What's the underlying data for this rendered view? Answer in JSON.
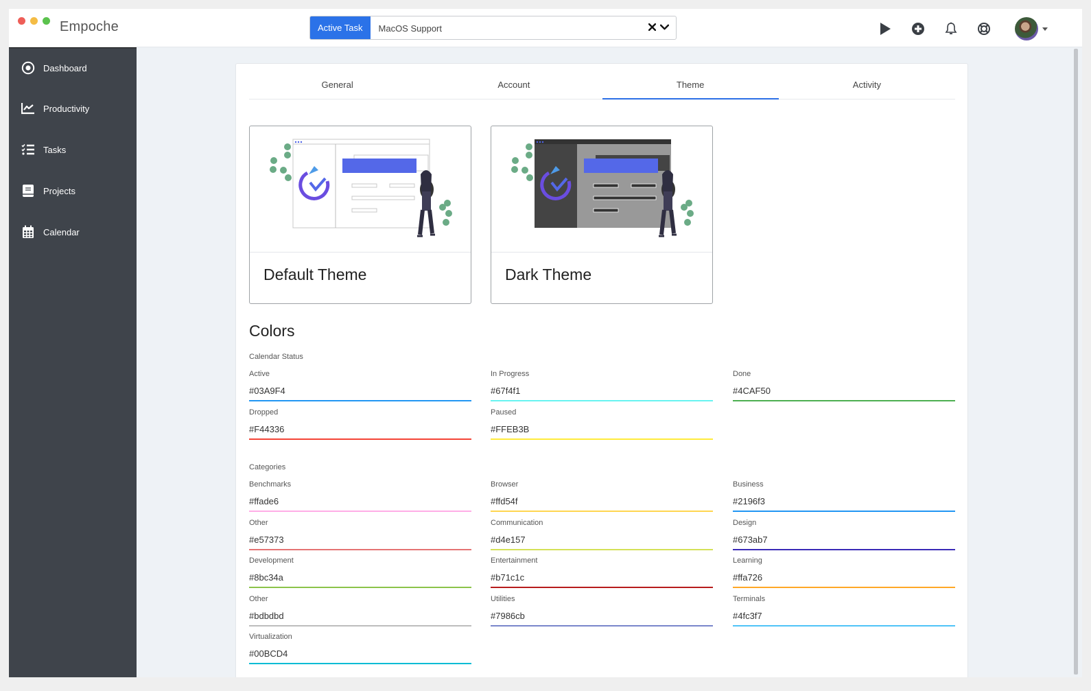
{
  "app": {
    "title": "Empoche"
  },
  "active_task": {
    "badge": "Active Task",
    "value": "MacOS Support",
    "clear_icon": "close-icon",
    "dropdown_icon": "chevron-down-icon"
  },
  "top_icons": [
    "play-icon",
    "plus-circle-icon",
    "bell-icon",
    "lifebuoy-icon",
    "avatar",
    "caret-down-icon"
  ],
  "sidebar": {
    "items": [
      {
        "label": "Dashboard",
        "icon": "dot-circle-icon"
      },
      {
        "label": "Productivity",
        "icon": "line-chart-icon"
      },
      {
        "label": "Tasks",
        "icon": "checklist-icon"
      },
      {
        "label": "Projects",
        "icon": "book-icon"
      },
      {
        "label": "Calendar",
        "icon": "calendar-icon"
      }
    ]
  },
  "tabs": [
    {
      "label": "General",
      "active": false
    },
    {
      "label": "Account",
      "active": false
    },
    {
      "label": "Theme",
      "active": true
    },
    {
      "label": "Activity",
      "active": false
    }
  ],
  "themes": [
    {
      "label": "Default Theme"
    },
    {
      "label": "Dark Theme"
    }
  ],
  "colors": {
    "title": "Colors",
    "calendar_status": {
      "label": "Calendar Status",
      "fields": [
        {
          "label": "Active",
          "value": "#03A9F4",
          "color": "#2196f3"
        },
        {
          "label": "In Progress",
          "value": "#67f4f1",
          "color": "#67f4f1"
        },
        {
          "label": "Done",
          "value": "#4CAF50",
          "color": "#4CAF50"
        },
        {
          "label": "Dropped",
          "value": "#F44336",
          "color": "#F44336"
        },
        {
          "label": "Paused",
          "value": "#FFEB3B",
          "color": "#FFEB3B"
        }
      ]
    },
    "categories": {
      "label": "Categories",
      "fields": [
        {
          "label": "Benchmarks",
          "value": "#ffade6",
          "color": "#ffade6"
        },
        {
          "label": "Browser",
          "value": "#ffd54f",
          "color": "#ffd54f"
        },
        {
          "label": "Business",
          "value": "#2196f3",
          "color": "#2196f3"
        },
        {
          "label": "Other",
          "value": "#e57373",
          "color": "#e57373"
        },
        {
          "label": "Communication",
          "value": "#d4e157",
          "color": "#d4e157"
        },
        {
          "label": "Design",
          "value": "#673ab7",
          "color": "#3a2ab7"
        },
        {
          "label": "Development",
          "value": "#8bc34a",
          "color": "#8bc34a"
        },
        {
          "label": "Entertainment",
          "value": "#b71c1c",
          "color": "#b71c1c"
        },
        {
          "label": "Learning",
          "value": "#ffa726",
          "color": "#ffa726"
        },
        {
          "label": "Other",
          "value": "#bdbdbd",
          "color": "#bdbdbd"
        },
        {
          "label": "Utilities",
          "value": "#7986cb",
          "color": "#7986cb"
        },
        {
          "label": "Terminals",
          "value": "#4fc3f7",
          "color": "#4fc3f7"
        },
        {
          "label": "Virtualization",
          "value": "#00BCD4",
          "color": "#00BCD4"
        }
      ]
    }
  }
}
